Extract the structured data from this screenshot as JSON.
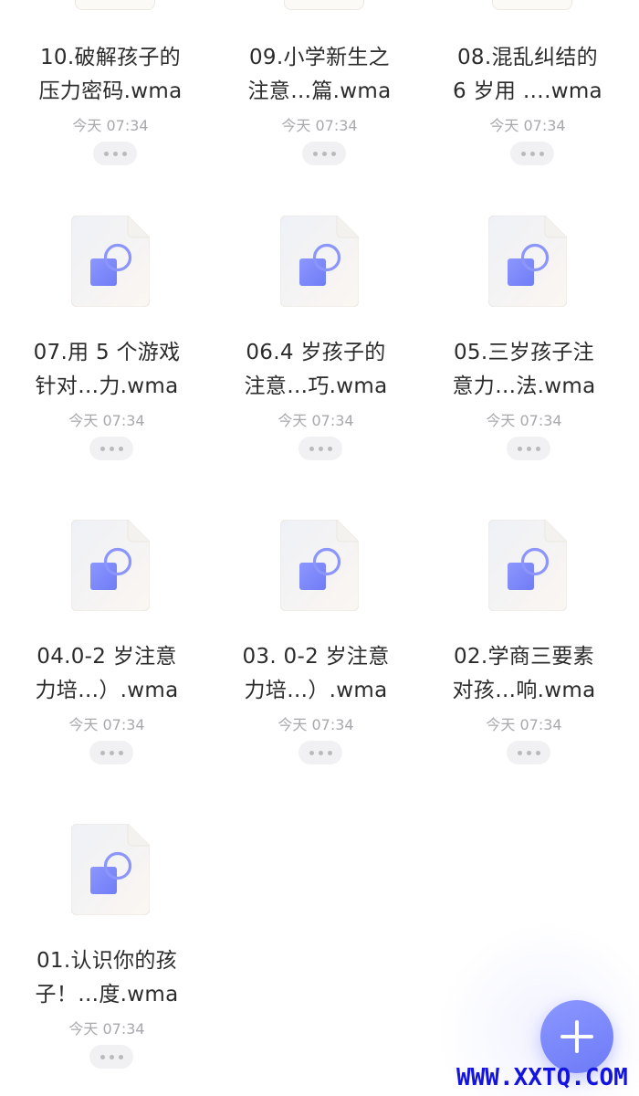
{
  "files": [
    {
      "line1": "10.破解孩子的",
      "line2": "压力密码.wma",
      "time": "今天 07:34"
    },
    {
      "line1": "09.小学新生之",
      "line2": "注意…篇.wma",
      "time": "今天 07:34"
    },
    {
      "line1": "08.混乱纠结的",
      "line2": "6 岁用 ….wma",
      "time": "今天 07:34"
    },
    {
      "line1": "07.用 5 个游戏",
      "line2": "针对…力.wma",
      "time": "今天 07:34"
    },
    {
      "line1": "06.4 岁孩子的",
      "line2": "注意…巧.wma",
      "time": "今天 07:34"
    },
    {
      "line1": "05.三岁孩子注",
      "line2": "意力…法.wma",
      "time": "今天 07:34"
    },
    {
      "line1": "04.0-2 岁注意",
      "line2": "力培…）.wma",
      "time": "今天 07:34"
    },
    {
      "line1": "03. 0-2 岁注意",
      "line2": "力培…）.wma",
      "time": "今天 07:34"
    },
    {
      "line1": "02.学商三要素",
      "line2": "对孩…响.wma",
      "time": "今天 07:34"
    },
    {
      "line1": "01.认识你的孩",
      "line2": "子！…度.wma",
      "time": "今天 07:34"
    }
  ],
  "icons": {
    "file": "audio-file-icon",
    "more": "more-options-icon",
    "fab": "plus-icon"
  },
  "colors": {
    "accent": "#7b87fa",
    "text": "#2b2b2b",
    "muted": "#a8a8ad",
    "watermark": "#1414e0"
  },
  "watermark": "WWW.XXTQ.COM"
}
